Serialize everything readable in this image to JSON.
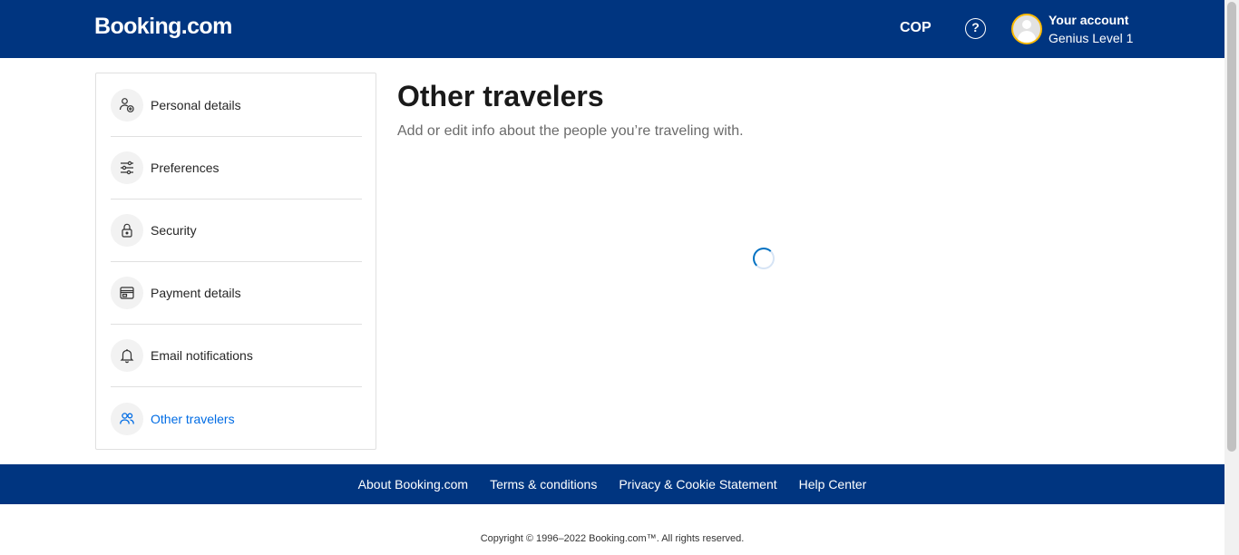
{
  "header": {
    "logo": "Booking.com",
    "currency": "COP",
    "help_icon": "question-circle-icon",
    "help_glyph": "?",
    "account_name": "Your account",
    "account_level": "Genius Level 1"
  },
  "sidebar": {
    "items": [
      {
        "label": "Personal details",
        "icon": "person-icon",
        "active": false
      },
      {
        "label": "Preferences",
        "icon": "sliders-icon",
        "active": false
      },
      {
        "label": "Security",
        "icon": "lock-icon",
        "active": false
      },
      {
        "label": "Payment details",
        "icon": "credit-card-icon",
        "active": false
      },
      {
        "label": "Email notifications",
        "icon": "bell-icon",
        "active": false
      },
      {
        "label": "Other travelers",
        "icon": "people-icon",
        "active": true
      }
    ]
  },
  "main": {
    "title": "Other travelers",
    "subtitle": "Add or edit info about the people you’re traveling with.",
    "loading": true
  },
  "footer": {
    "links": [
      "About Booking.com",
      "Terms & conditions",
      "Privacy & Cookie Statement",
      "Help Center"
    ],
    "copyright": "Copyright © 1996–2022 Booking.com™. All rights reserved."
  },
  "colors": {
    "brand_blue": "#003580",
    "active_link": "#006ce4",
    "genius_yellow": "#febb02"
  }
}
